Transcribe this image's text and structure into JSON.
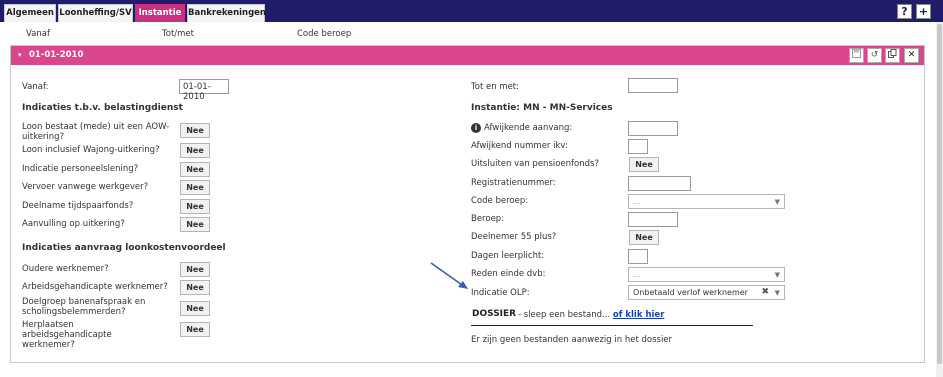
{
  "tabs": [
    {
      "label": "Algemeen"
    },
    {
      "label": "Loonheffing/SV"
    },
    {
      "label": "Instantie"
    },
    {
      "label": "Bankrekeningen"
    }
  ],
  "active_tab": "Instantie",
  "top_buttons": {
    "help": "?",
    "add": "+"
  },
  "columns": {
    "vanaf": "Vanaf",
    "tot_met": "Tot/met",
    "code_beroep": "Code beroep"
  },
  "panel": {
    "title": "01-01-2010",
    "header_icons": [
      "save-icon",
      "undo-icon",
      "copy-icon",
      "close-icon"
    ],
    "close_glyph": "✕"
  },
  "left": {
    "vanaf_label": "Vanaf:",
    "vanaf_value": "01-01-2010",
    "section1_title": "Indicaties t.b.v. belastingdienst",
    "section1_items": [
      {
        "label": "Loon bestaat (mede) uit een AOW-uitkering?",
        "value": "Nee"
      },
      {
        "label": "Loon inclusief Wajong-uitkering?",
        "value": "Nee"
      },
      {
        "label": "Indicatie personeelslening?",
        "value": "Nee"
      },
      {
        "label": "Vervoer vanwege werkgever?",
        "value": "Nee"
      },
      {
        "label": "Deelname tijdspaarfonds?",
        "value": "Nee"
      },
      {
        "label": "Aanvulling op uitkering?",
        "value": "Nee"
      }
    ],
    "section2_title": "Indicaties aanvraag loonkostenvoordeel",
    "section2_items": [
      {
        "label": "Oudere werknemer?",
        "value": "Nee"
      },
      {
        "label": "Arbeidsgehandicapte werknemer?",
        "value": "Nee"
      },
      {
        "label": "Doelgroep banenafspraak en scholingsbelemmerden?",
        "value": "Nee"
      },
      {
        "label": "Herplaatsen arbeidsgehandicapte werknemer?",
        "value": "Nee"
      }
    ]
  },
  "right": {
    "tot_label": "Tot en met:",
    "tot_value": "",
    "instantie_title": "Instantie: MN - MN-Services",
    "afwijkende_aanvang": "Afwijkende aanvang:",
    "afwijkend_nummer_ikv": "Afwijkend nummer ikv:",
    "uitsluiten_pensioen": "Uitsluiten van pensioenfonds?",
    "uitsluiten_value": "Nee",
    "registratienummer": "Registratienummer:",
    "code_beroep_label": "Code beroep:",
    "code_beroep_placeholder": "...",
    "beroep_label": "Beroep:",
    "deelnemer55_label": "Deelnemer 55 plus?",
    "deelnemer55_value": "Nee",
    "dagen_leerplicht": "Dagen leerplicht:",
    "reden_einde_label": "Reden einde dvb:",
    "reden_einde_placeholder": "...",
    "indicatie_olp_label": "Indicatie OLP:",
    "indicatie_olp_value": "Onbetaald verlof werknemer"
  },
  "dossier": {
    "title": "DOSSIER",
    "drop_text": "- sleep een bestand...",
    "link_text": "of klik hier",
    "empty_text": "Er zijn geen bestanden aanwezig in het dossier"
  },
  "colors": {
    "nav": "#1f1d6b",
    "accent": "#c9307e",
    "panel_header": "#d9468e",
    "arrow": "#3d5ea8"
  }
}
